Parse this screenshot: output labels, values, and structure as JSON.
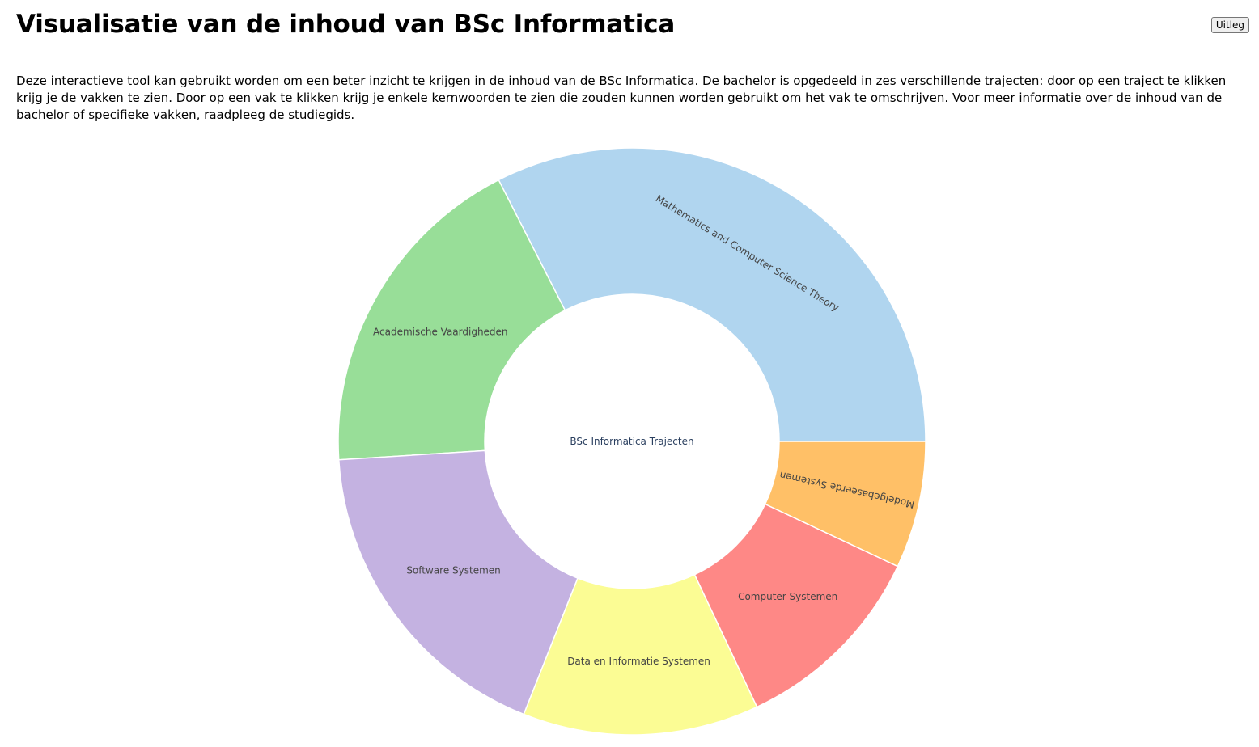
{
  "header": {
    "title": "Visualisatie van de inhoud van BSc Informatica",
    "help_button_label": "Uitleg"
  },
  "intro": {
    "text": "Deze interactieve tool kan gebruikt worden om een beter inzicht te krijgen in de inhoud van de BSc Informatica. De bachelor is opgedeeld in zes verschillende trajecten: door op een traject te klikken krijg je de vakken te zien. Door op een vak te klikken krijg je enkele kernwoorden te zien die zouden kunnen worden gebruikt om het vak te omschrijven. Voor meer informatie over de inhoud van de bachelor of specifieke vakken, raadpleeg de studiegids."
  },
  "chart_data": {
    "type": "pie",
    "hole": true,
    "center_label": "BSc Informatica Trajecten",
    "direction": "counterclockwise",
    "start_angle_deg": 0,
    "slices": [
      {
        "label": "Mathematics and Computer Science Theory",
        "value": 32.5,
        "color": "#b0d5ef"
      },
      {
        "label": "Academische Vaardigheden",
        "value": 18.5,
        "color": "#98de98"
      },
      {
        "label": "Software Systemen",
        "value": 18.0,
        "color": "#c4b2e1"
      },
      {
        "label": "Data en Informatie Systemen",
        "value": 13.0,
        "color": "#fbfc94"
      },
      {
        "label": "Computer Systemen",
        "value": 11.0,
        "color": "#fe8886"
      },
      {
        "label": "Modelgebaseerde Systemen",
        "value": 7.0,
        "color": "#ffc067"
      }
    ]
  }
}
